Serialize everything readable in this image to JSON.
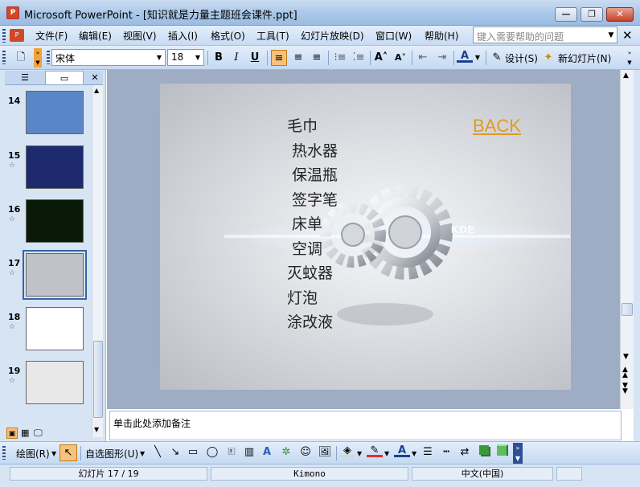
{
  "window": {
    "title": "Microsoft PowerPoint - [知识就是力量主题班会课件.ppt]"
  },
  "menu": [
    "文件(F)",
    "编辑(E)",
    "视图(V)",
    "插入(I)",
    "格式(O)",
    "工具(T)",
    "幻灯片放映(D)",
    "窗口(W)",
    "帮助(H)"
  ],
  "help_search": {
    "placeholder": "键入需要帮助的问题"
  },
  "toolbar": {
    "font_name": "宋体",
    "font_size": "18",
    "bold": "B",
    "italic": "I",
    "underline": "U",
    "design_label": "设计(S)",
    "new_slide_label": "新幻灯片(N)"
  },
  "thumbnails": [
    {
      "num": "14",
      "star": "",
      "bg": "#5a86c8"
    },
    {
      "num": "15",
      "star": "☆",
      "bg": "#1d2a6e"
    },
    {
      "num": "16",
      "star": "☆",
      "bg": "#0a1a08"
    },
    {
      "num": "17",
      "star": "☆",
      "bg": "#bfc3c9"
    },
    {
      "num": "18",
      "star": "☆",
      "bg": "#ffffff"
    },
    {
      "num": "19",
      "star": "☆",
      "bg": "#e8e8e8"
    }
  ],
  "slide": {
    "items": [
      "毛巾",
      "热水器",
      "保温瓶",
      "签字笔",
      "床单",
      "空调",
      "灭蚊器",
      "灯泡",
      "涂改液"
    ],
    "back_label": "BACK",
    "logo_text": "KDE"
  },
  "notes": {
    "placeholder": "单击此处添加备注"
  },
  "drawbar": {
    "draw_label": "绘图(R)",
    "autoshape_label": "自选图形(U)"
  },
  "status": {
    "slide_pos": "幻灯片 17 / 19",
    "theme": "Kimono",
    "language": "中文(中国)"
  },
  "colors": {
    "link": "#e39a1d",
    "selected_thumb_border": "#3465a4"
  }
}
